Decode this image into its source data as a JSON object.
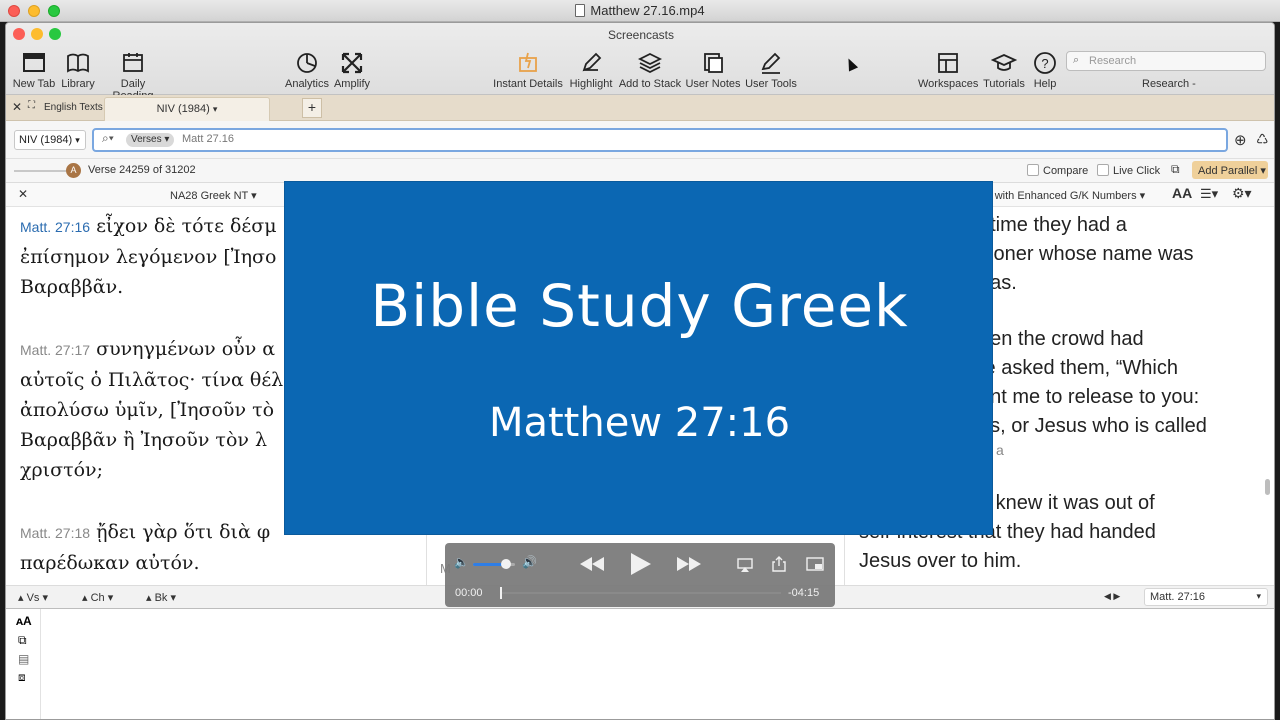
{
  "quicktime": {
    "title": "Matthew 27.16.mp4"
  },
  "app": {
    "title": "Screencasts"
  },
  "toolbar": {
    "new_tab": "New Tab",
    "library": "Library",
    "daily_reading": "Daily Reading",
    "analytics": "Analytics",
    "amplify": "Amplify",
    "instant_details": "Instant Details",
    "highlight": "Highlight",
    "add_to_stack": "Add to Stack",
    "user_notes": "User Notes",
    "user_tools": "User Tools",
    "workspaces": "Workspaces",
    "tutorials": "Tutorials",
    "help": "Help",
    "search_placeholder": "Research",
    "research_menu": "Research -"
  },
  "tabs": {
    "english_texts": "English Texts",
    "active_tab": "NIV (1984)",
    "new_tab_symbol": "+"
  },
  "refbar": {
    "version": "NIV (1984)",
    "scope": "Verses",
    "reference": "Matt 27.16"
  },
  "inforow": {
    "badge": "A",
    "verse_info": "Verse 24259 of 31202",
    "compare": "Compare",
    "live_click": "Live Click",
    "add_parallel": "Add Parallel"
  },
  "left_pane": {
    "title": "NA28 Greek NT",
    "verses": [
      {
        "ref": "Matt. 27:16",
        "lines": [
          "εἶχον δὲ τότε δέσμ",
          "ἐπίσημον λεγόμενον [Ἰησο",
          "Βαραββᾶν."
        ]
      },
      {
        "ref": "Matt. 27:17",
        "lines": [
          "συνηγμένων οὖν α",
          "αὐτοῖς ὁ Πιλᾶτος· τίνα θέλ",
          "ἀπολύσω ὑμῖν, [Ἰησοῦν τὸ",
          "Βαραββᾶν ἢ Ἰησοῦν τὸν λ",
          "χριστόν;"
        ]
      },
      {
        "ref": "Matt. 27:18",
        "lines": [
          "ᾔδει γὰρ ὅτι διὰ φ",
          "παρέδωκαν αὐτόν."
        ]
      }
    ]
  },
  "right_pane": {
    "title": ") with Enhanced G/K Numbers",
    "font_icon": "AA",
    "lines": [
      "t time they had a",
      "isoner whose name was",
      "bas.",
      "hen the crowd had",
      "te asked them, “Which",
      "ant me to release to you:",
      "as, or Jesus who is called",
      "a",
      "e knew it was out of",
      "self-interest that they had handed",
      "Jesus over to him."
    ],
    "nav_ref": "Matt. 27:16"
  },
  "bottom": {
    "vs": "Vs",
    "ch": "Ch",
    "bk": "Bk",
    "middle_letter": "M"
  },
  "overlay": {
    "title": "Bible Study Greek",
    "subtitle": "Matthew 27:16"
  },
  "player": {
    "elapsed": "00:00",
    "remaining": "-04:15",
    "volume": 0.78,
    "progress": 0.0
  },
  "colors": {
    "overlay": "#0b67b3",
    "add_parallel": "#efd09a",
    "ref_link": "#2b6cb0"
  }
}
